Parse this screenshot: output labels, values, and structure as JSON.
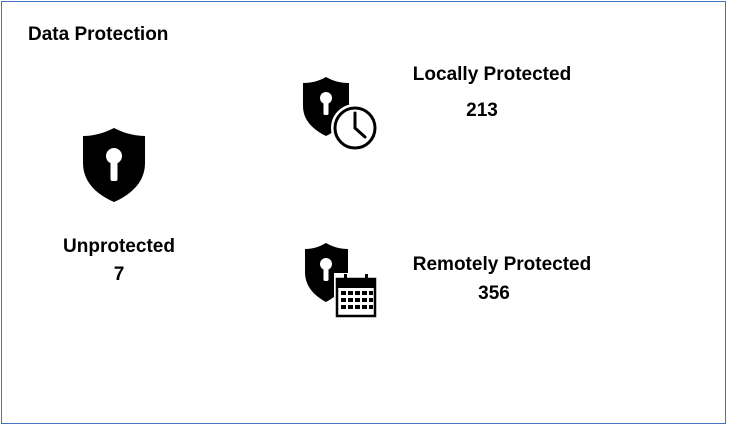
{
  "panel": {
    "title": "Data Protection",
    "border_color": "#4472c4"
  },
  "stats": {
    "unprotected": {
      "label": "Unprotected",
      "value": "7",
      "icon": "shield-keyhole-icon"
    },
    "locally_protected": {
      "label": "Locally Protected",
      "value": "213",
      "icon": "shield-clock-icon"
    },
    "remotely_protected": {
      "label": "Remotely Protected",
      "value": "356",
      "icon": "shield-calendar-icon"
    }
  }
}
